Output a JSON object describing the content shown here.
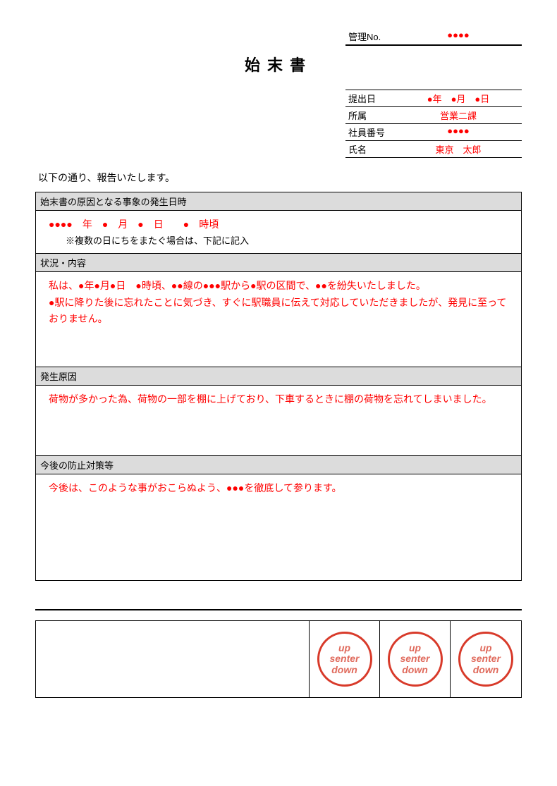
{
  "header": {
    "mgmt_label": "管理No.",
    "mgmt_value": "●●●●",
    "title": "始末書",
    "rows": [
      {
        "label": "提出日",
        "value": "●年　●月　●日"
      },
      {
        "label": "所属",
        "value": "営業二課"
      },
      {
        "label": "社員番号",
        "value": "●●●●"
      },
      {
        "label": "氏名",
        "value": "東京　太郎"
      }
    ]
  },
  "intro": "以下の通り、報告いたします。",
  "sections": {
    "occurrence": {
      "title": "始末書の原因となる事象の発生日時",
      "line": "●●●●　年　●　月　●　日　　●　時頃",
      "note": "※複数の日にちをまたぐ場合は、下記に記入"
    },
    "situation": {
      "title": "状況・内容",
      "p1": "私は、●年●月●日　●時頃、●●線の●●●駅から●駅の区間で、●●を紛失いたしました。",
      "p2": "●駅に降りた後に忘れたことに気づき、すぐに駅職員に伝えて対応していただきましたが、発見に至っておりません。"
    },
    "cause": {
      "title": "発生原因",
      "p1": "荷物が多かった為、荷物の一部を棚に上げており、下車するときに棚の荷物を忘れてしまいました。"
    },
    "prevent": {
      "title": "今後の防止対策等",
      "p1": "今後は、このような事がおこらぬよう、●●●を徹底して参ります。"
    }
  },
  "stamp": {
    "l1": "up",
    "l2": "senter",
    "l3": "down"
  }
}
